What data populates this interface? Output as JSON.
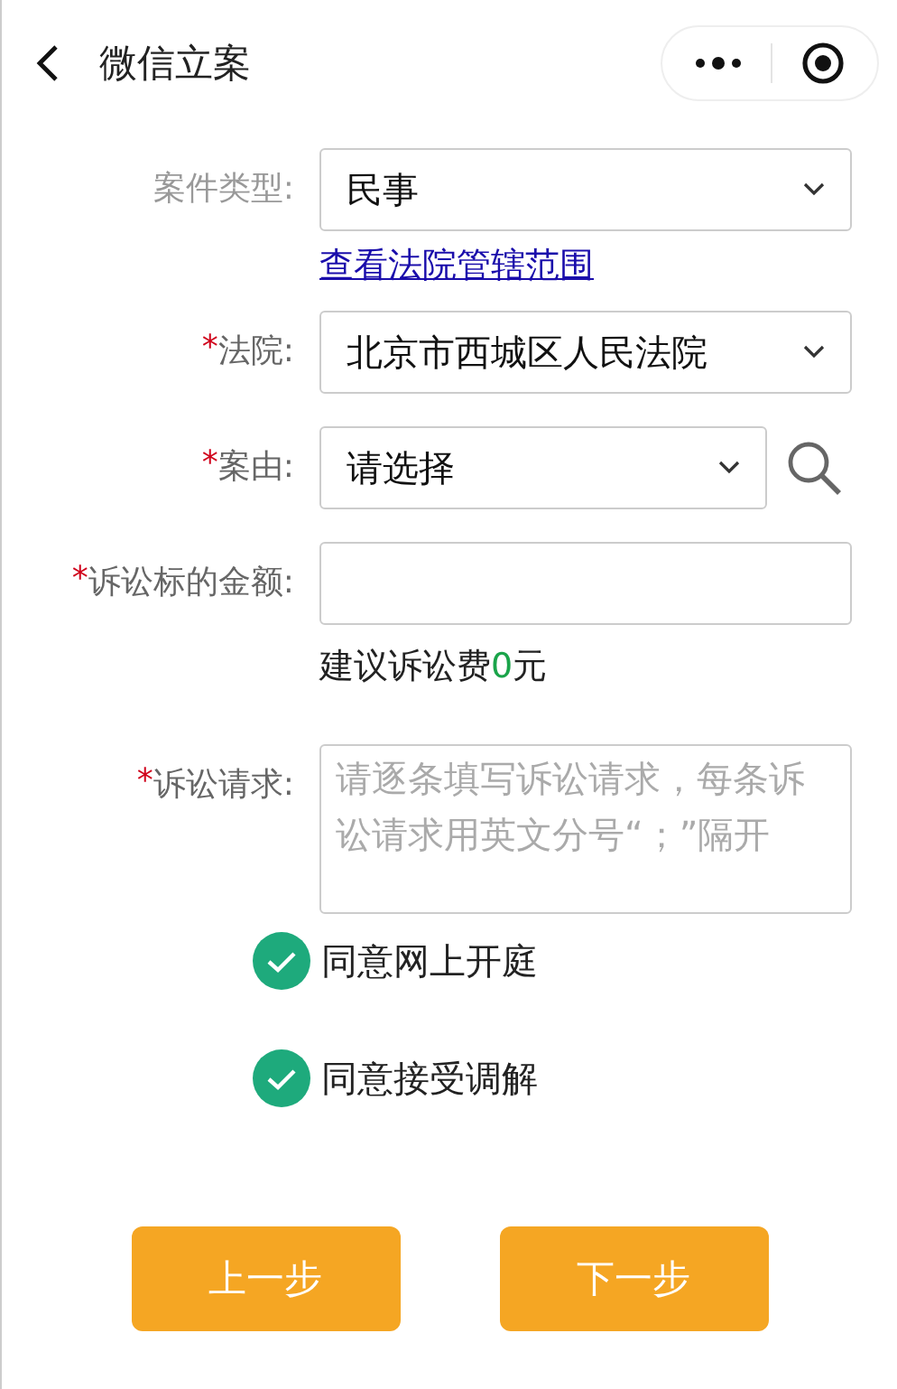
{
  "header": {
    "title": "微信立案"
  },
  "form": [
    {
      "kind": "select",
      "label": "案件类型:",
      "value": "民事"
    },
    {
      "kind": "link",
      "text": "查看法院管辖范围"
    },
    {
      "kind": "select",
      "mark": "*",
      "label": "法院:",
      "value": "北京市西城区人民法院"
    },
    {
      "kind": "select_search",
      "mark": "*",
      "label": "案由:",
      "value": "请选择"
    },
    {
      "kind": "input",
      "mark": "*",
      "label": "诉讼标的金额:"
    },
    {
      "kind": "fee",
      "prefix": "建议诉讼费",
      "amount": "0",
      "suffix": "元"
    },
    {
      "kind": "textarea",
      "mark": "*",
      "label": "诉讼请求:",
      "placeholder": "请逐条填写诉讼请求，每条诉讼请求用英文分号“；”隔开"
    }
  ],
  "agreements": [
    {
      "label": "同意网上开庭",
      "checked": true
    },
    {
      "label": "同意接受调解",
      "checked": true
    }
  ],
  "buttons": [
    "上一步",
    "下一步"
  ]
}
